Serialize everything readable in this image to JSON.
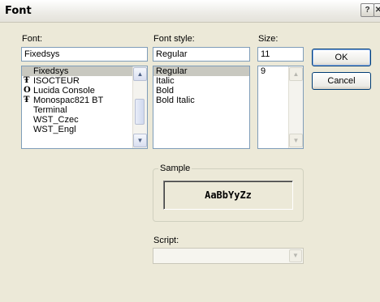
{
  "window": {
    "title": "Font",
    "help_glyph": "?",
    "close_glyph": "✕"
  },
  "font": {
    "label": "Font:",
    "value": "Fixedsys",
    "items": [
      {
        "name": "Fixedsys",
        "icon": "",
        "selected": true
      },
      {
        "name": "ISOCTEUR",
        "icon": "truetype-icon",
        "selected": false
      },
      {
        "name": "Lucida Console",
        "icon": "opentype-icon",
        "selected": false
      },
      {
        "name": "Monospac821 BT",
        "icon": "truetype-icon",
        "selected": false
      },
      {
        "name": "Terminal",
        "icon": "",
        "selected": false
      },
      {
        "name": "WST_Czec",
        "icon": "",
        "selected": false
      },
      {
        "name": "WST_Engl",
        "icon": "",
        "selected": false
      }
    ]
  },
  "style": {
    "label": "Font style:",
    "value": "Regular",
    "items": [
      {
        "name": "Regular",
        "selected": true
      },
      {
        "name": "Italic",
        "selected": false
      },
      {
        "name": "Bold",
        "selected": false
      },
      {
        "name": "Bold Italic",
        "selected": false
      }
    ]
  },
  "size": {
    "label": "Size:",
    "value": "11",
    "items": [
      {
        "name": "9",
        "selected": false
      }
    ]
  },
  "buttons": {
    "ok": "OK",
    "cancel": "Cancel"
  },
  "sample": {
    "label": "Sample",
    "text": "AaBbYyZz"
  },
  "script": {
    "label": "Script:",
    "value": ""
  },
  "colors": {
    "dialog_bg": "#ece9d8",
    "field_border": "#7f9db9",
    "selection": "#c8c8c0",
    "default_button_border": "#003c74"
  }
}
